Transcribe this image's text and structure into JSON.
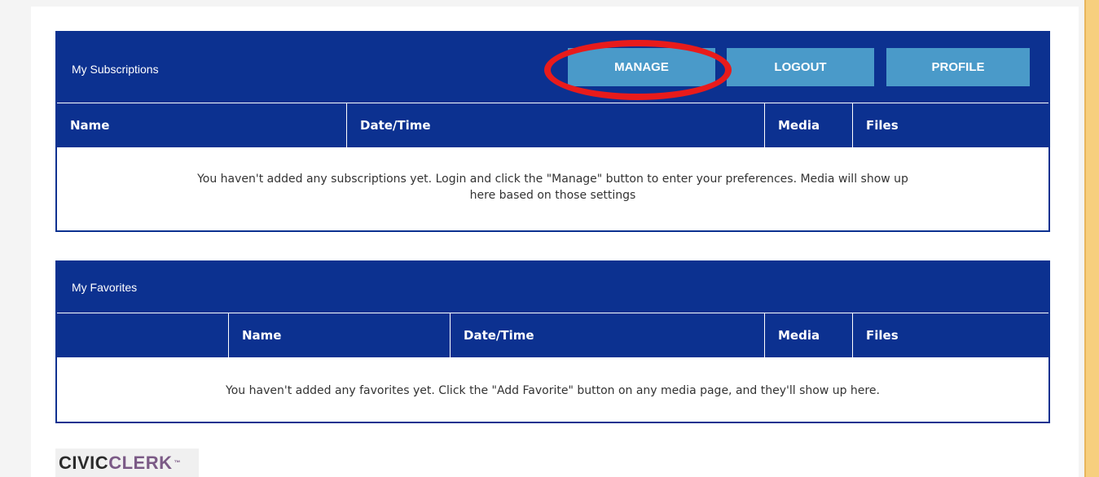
{
  "subscriptions": {
    "title": "My Subscriptions",
    "buttons": {
      "manage": "MANAGE",
      "logout": "LOGOUT",
      "profile": "PROFILE"
    },
    "columns": [
      "Name",
      "Date/Time",
      "Media",
      "Files"
    ],
    "empty_message_line1": "You haven't added any subscriptions yet. Login and click the \"Manage\" button to enter your preferences. Media will show up",
    "empty_message_line2": "here based on those settings"
  },
  "favorites": {
    "title": "My Favorites",
    "columns": [
      "",
      "Name",
      "Date/Time",
      "Media",
      "Files"
    ],
    "empty_message": "You haven't added any favorites yet. Click the \"Add Favorite\" button on any media page, and they'll show up here."
  },
  "logo": {
    "part1": "CIVIC",
    "part2": "CLERK",
    "mark": "™"
  },
  "colors": {
    "header": "#0c3190",
    "button": "#4a9ac9",
    "highlight": "#e81b1b",
    "sidebar": "#f7cf7e"
  }
}
